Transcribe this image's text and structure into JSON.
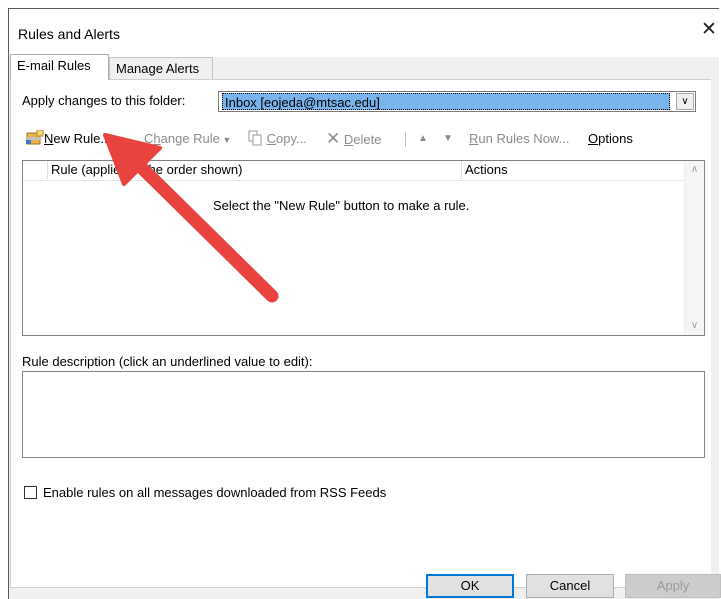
{
  "window": {
    "title": "Rules and Alerts",
    "close_glyph": "✕"
  },
  "tabs": [
    {
      "label": "E-mail Rules",
      "active": true
    },
    {
      "label": "Manage Alerts",
      "active": false
    }
  ],
  "folder": {
    "label": "Apply changes to this folder:",
    "value": "Inbox [eojeda@mtsac.edu]"
  },
  "toolbar": {
    "new_rule": {
      "prefix": "N",
      "rest": "ew Rule..."
    },
    "change_rule": {
      "a": "C",
      "b": "h",
      "c": "ange Rule"
    },
    "copy": {
      "u": "C",
      "rest": "opy..."
    },
    "delete": {
      "u": "D",
      "rest": "elete"
    },
    "run_rules": {
      "u": "R",
      "rest": "un Rules Now..."
    },
    "options": {
      "u": "O",
      "rest": "ptions"
    }
  },
  "rules_list": {
    "columns": [
      "Rule (applied in the order shown)",
      "Actions"
    ],
    "empty_message": "Select the \"New Rule\" button to make a rule."
  },
  "description": {
    "label": "Rule description (click an underlined value to edit):"
  },
  "rss": {
    "label": "Enable rules on all messages downloaded from RSS Feeds",
    "checked": false
  },
  "buttons": {
    "ok": "OK",
    "cancel": "Cancel",
    "apply": "Apply"
  },
  "colors": {
    "arrow": "#e8433e",
    "selection": "#79b4ec",
    "focus": "#0078d7"
  }
}
